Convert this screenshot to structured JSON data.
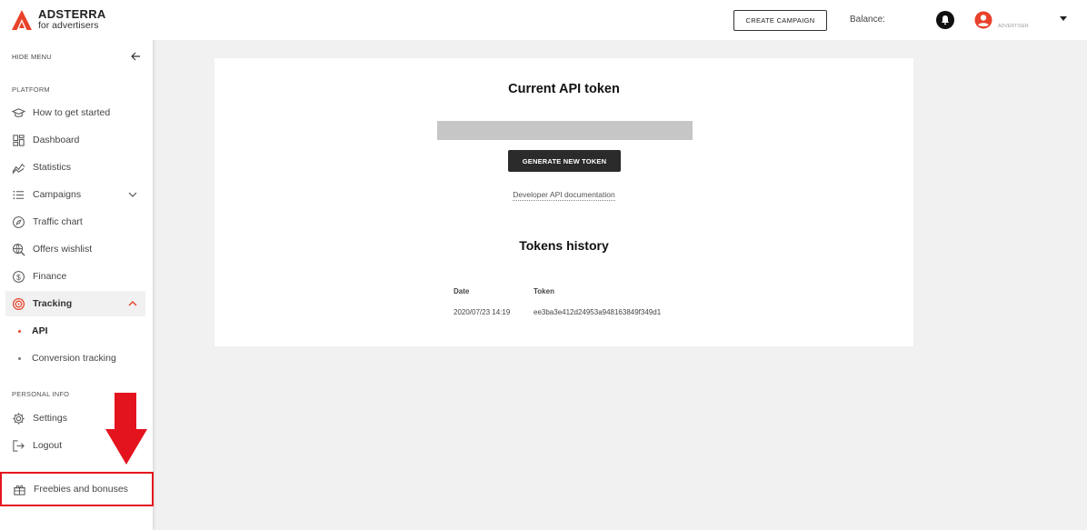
{
  "brand": {
    "name": "ADSTERRA",
    "sub": "for advertisers",
    "accent": "#e8422a"
  },
  "sidebar": {
    "hide_menu": "HIDE MENU",
    "platform_label": "PLATFORM",
    "items": [
      {
        "label": "How to get started",
        "icon": "graduation-cap-icon"
      },
      {
        "label": "Dashboard",
        "icon": "dashboard-icon"
      },
      {
        "label": "Statistics",
        "icon": "statistics-icon"
      },
      {
        "label": "Campaigns",
        "icon": "list-icon"
      },
      {
        "label": "Traffic chart",
        "icon": "compass-icon"
      },
      {
        "label": "Offers wishlist",
        "icon": "search-globe-icon"
      },
      {
        "label": "Finance",
        "icon": "dollar-icon"
      },
      {
        "label": "Tracking",
        "icon": "target-icon"
      }
    ],
    "tracking_sub": [
      {
        "label": "API"
      },
      {
        "label": "Conversion tracking"
      }
    ],
    "personal_label": "PERSONAL INFO",
    "personal_items": [
      {
        "label": "Settings",
        "icon": "gear-icon"
      },
      {
        "label": "Logout",
        "icon": "logout-icon"
      }
    ],
    "freebies": {
      "label": "Freebies and bonuses",
      "icon": "gift-icon"
    }
  },
  "header": {
    "create_campaign": "CREATE CAMPAIGN",
    "balance_label": "Balance:",
    "role": "ADVERTISER"
  },
  "main": {
    "current_token_title": "Current API token",
    "generate_button": "GENERATE NEW TOKEN",
    "doc_link": "Developer API documentation",
    "history_title": "Tokens history",
    "history_columns": [
      "Date",
      "Token"
    ],
    "history_rows": [
      {
        "date": "2020/07/23 14:19",
        "token": "ee3ba3e412d24953a948163849f349d1"
      }
    ]
  },
  "colors": {
    "accent": "#e8422a",
    "highlight": "#e4141e",
    "dark_button": "#2b2b2b"
  }
}
